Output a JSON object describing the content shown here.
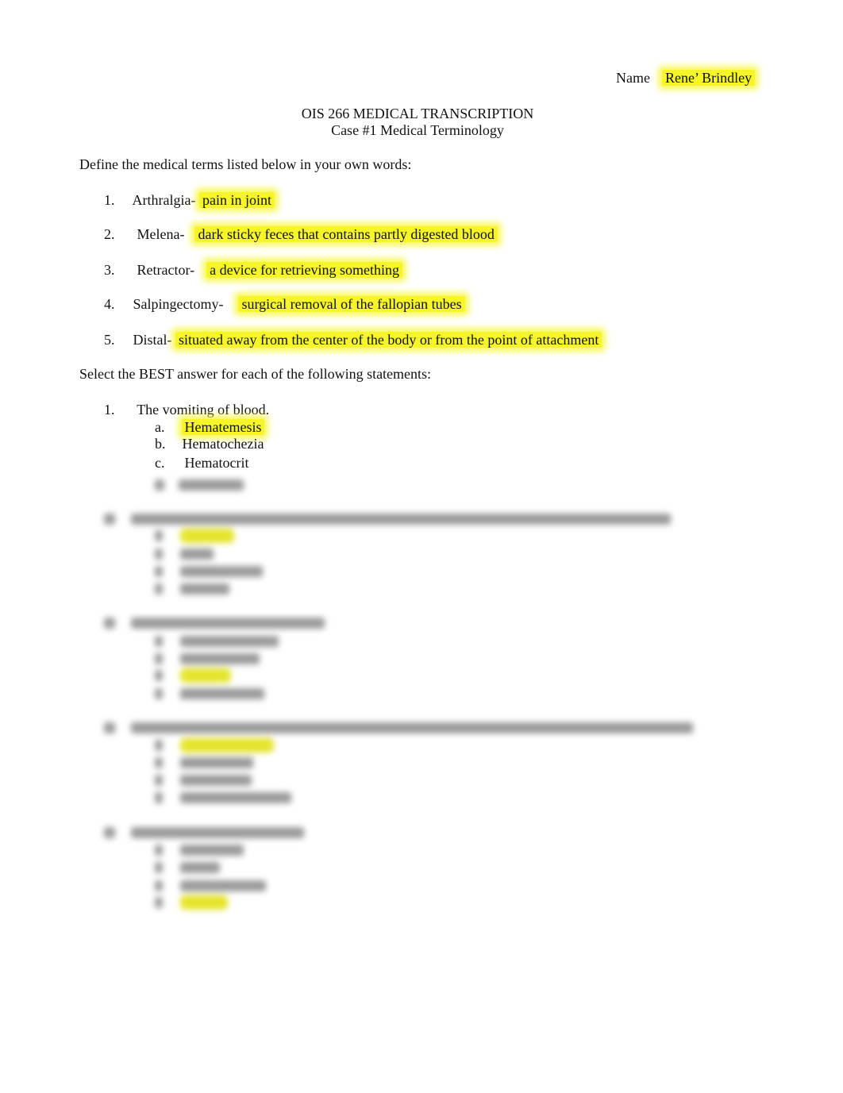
{
  "header": {
    "name_label": "Name",
    "name_value": "Rene’ Brindley",
    "title": "OIS 266 MEDICAL TRANSCRIPTION",
    "subtitle": "Case #1 Medical Terminology"
  },
  "section1": {
    "instruction": "Define the medical terms listed below in your own words:",
    "items": [
      {
        "num": "1.",
        "term": "Arthralgia-",
        "answer": "pain in joint"
      },
      {
        "num": "2.",
        "term": "Melena-",
        "answer": "dark sticky feces that contains partly digested blood"
      },
      {
        "num": "3.",
        "term": "Retractor-",
        "answer": "a device for retrieving something"
      },
      {
        "num": "4.",
        "term": "Salpingectomy-",
        "answer": "surgical removal of the fallopian tubes"
      },
      {
        "num": "5.",
        "term": "Distal-",
        "answer": "situated away from the center of the body or from the point of attachment"
      }
    ]
  },
  "section2": {
    "instruction": "Select the BEST answer for each of the following statements:",
    "q1": {
      "num": "1.",
      "question": "The vomiting of blood.",
      "options": [
        {
          "letter": "a.",
          "text": "Hematemesis",
          "selected": true
        },
        {
          "letter": "b.",
          "text": "Hematochezia",
          "selected": false
        },
        {
          "letter": "c.",
          "text": "Hematocrit",
          "selected": false
        }
      ]
    },
    "blurred_note": "Remaining questions (2-5) are blurred/obscured in the screenshot"
  },
  "colors": {
    "highlight": "#f5f52a",
    "text": "#111111"
  }
}
